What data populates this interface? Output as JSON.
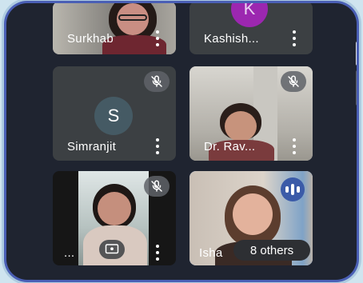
{
  "participants": [
    {
      "name": "Surkhab",
      "muted": false
    },
    {
      "name": "Kashish...",
      "initial": "K",
      "muted": false
    },
    {
      "name": "Simranjit",
      "initial": "S",
      "muted": true
    },
    {
      "name": "Dr. Rav...",
      "muted": true
    },
    {
      "name": "...",
      "muted": true,
      "extra_icon": "present-screen-icon"
    },
    {
      "name": "Isha",
      "speaking": true
    }
  ],
  "others_chip": {
    "label": "8 others"
  },
  "colors": {
    "avatar_k": "#9c27b0",
    "avatar_s": "#455a64",
    "speaking_border": "#8ab4f8",
    "tile_bg": "#3c4043"
  }
}
